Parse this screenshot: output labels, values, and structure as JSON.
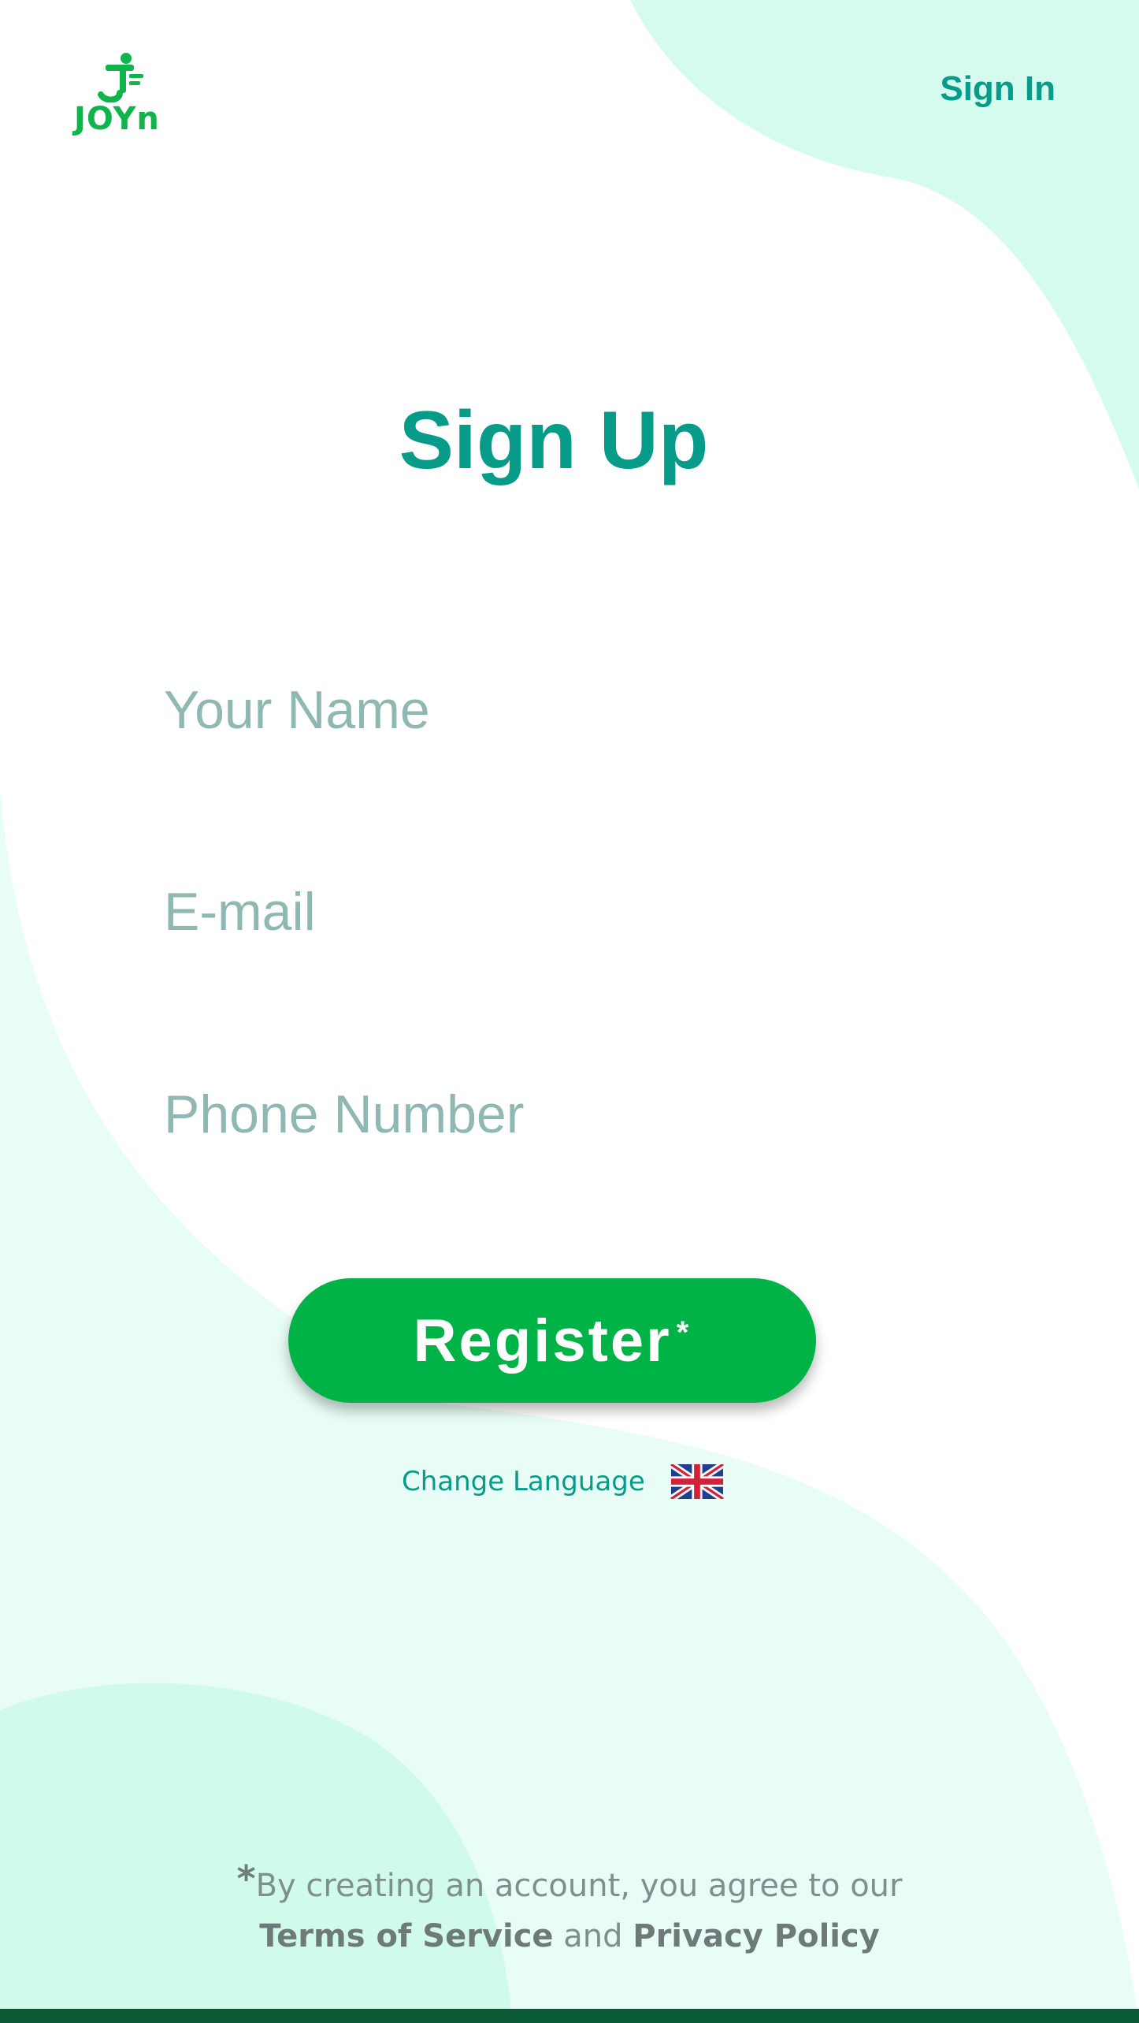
{
  "brand": {
    "logo_text": "JOYn",
    "logo_icon": "joyn-runner-icon"
  },
  "header": {
    "sign_in_label": "Sign In"
  },
  "main": {
    "title": "Sign Up",
    "fields": {
      "name_placeholder": "Your Name",
      "email_placeholder": "E-mail",
      "phone_placeholder": "Phone Number"
    },
    "register_label": "Register",
    "register_mark": "*",
    "change_language_label": "Change Language",
    "language_flag_icon": "uk-flag-icon"
  },
  "footer": {
    "asterisk": "*",
    "agreement_text": "By creating an account, you agree to our",
    "terms_label": "Terms of Service",
    "and_text": "and",
    "privacy_label": "Privacy Policy"
  },
  "colors": {
    "accent_teal": "#079b8a",
    "button_green": "#00b347",
    "logo_green": "#0fb54a",
    "mint_background": "#d8fbef",
    "footer_bar": "#0a5a35"
  }
}
